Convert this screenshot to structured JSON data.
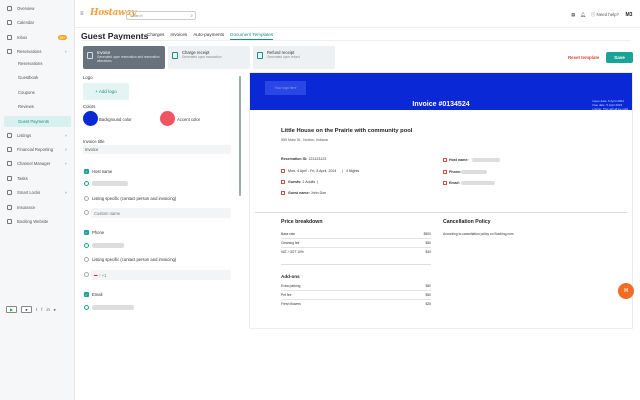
{
  "sidebar": {
    "items": [
      {
        "label": "Overview"
      },
      {
        "label": "Calendar"
      },
      {
        "label": "Inbox",
        "badge": "99+"
      },
      {
        "label": "Reservations"
      },
      {
        "label": "Reservations",
        "sub": true
      },
      {
        "label": "Guestbook",
        "sub": true
      },
      {
        "label": "Coupons",
        "sub": true
      },
      {
        "label": "Reviews",
        "sub": true
      },
      {
        "label": "Guest Payments",
        "sub": true,
        "active": true
      },
      {
        "label": "Listings"
      },
      {
        "label": "Financial Reporting"
      },
      {
        "label": "Channel Manager"
      },
      {
        "label": "Tasks"
      },
      {
        "label": "Smart Locks"
      },
      {
        "label": "Insurance"
      },
      {
        "label": "Booking Website"
      }
    ]
  },
  "topbar": {
    "logo": "Hostaway",
    "search_placeholder": "Search",
    "help": "Need help?",
    "avatar": "M3"
  },
  "header": {
    "title": "Guest Payments",
    "tabs": [
      "Charges",
      "Invoices",
      "Auto-payments",
      "Document Templates"
    ],
    "active_tab": "Document Templates"
  },
  "templates": [
    {
      "title": "Invoice",
      "desc": "Generated upon reservation and reservation alterations"
    },
    {
      "title": "Charge receipt",
      "desc": "Generated upon transaction"
    },
    {
      "title": "Refund receipt",
      "desc": "Generated upon refund"
    }
  ],
  "actions": {
    "reset": "Reset template",
    "save": "Save"
  },
  "editor": {
    "logo_label": "Logo",
    "add_logo": "+ Add logo",
    "colors_label": "Colors",
    "bg_color_label": "Background color",
    "accent_color_label": "Accent color",
    "bg_color": "#0a28d6",
    "accent_color": "#f05560",
    "invoice_title_label": "Invoice title",
    "invoice_title_value": "Invoice",
    "host_name": "Host name",
    "listing_specific": "Listing specific (contact person and invoicing)",
    "custom_name": "Custom name",
    "phone": "Phone",
    "phone_prefix": "+1",
    "email": "Email"
  },
  "preview": {
    "logo_placeholder": "Your logo here",
    "invoice_title": "Invoice #0134524",
    "issue_date": "Issue date: 5 April 2024",
    "due_date": "Due date: 5 April 2024",
    "note": "Listing: This will all be paid",
    "listing_name": "Little House on the Prairie with community pool",
    "address": "555 Main St., Norton, Indiana",
    "reservation_label": "Reservation ID:",
    "reservation_id": "123123123",
    "dates": "Mon, 4 April - Fri, 8 April, 2024",
    "nights": "4 Nights",
    "guests_label": "Guests:",
    "guests": "2 Adults",
    "guest_name_label": "Guest name:",
    "guest_name": "John Doe",
    "host_label": "Host name:",
    "phone_label": "Phone:",
    "email_label": "Email:",
    "price_title": "Price breakdown",
    "prices": [
      {
        "label": "Base rate",
        "value": "$500"
      },
      {
        "label": "Cleaning fee",
        "value": "$50"
      },
      {
        "label": "VAT / GST 10%",
        "value": "$40"
      }
    ],
    "addons_title": "Add-ons",
    "addons": [
      {
        "label": "Extra parking",
        "value": "$50"
      },
      {
        "label": "Pet fee",
        "value": "$50"
      },
      {
        "label": "Fresh flowers",
        "value": "$25"
      }
    ],
    "cancel_title": "Cancellation Policy",
    "cancel_text": "According to cancellation policy on Booking.com"
  },
  "fab": "H"
}
